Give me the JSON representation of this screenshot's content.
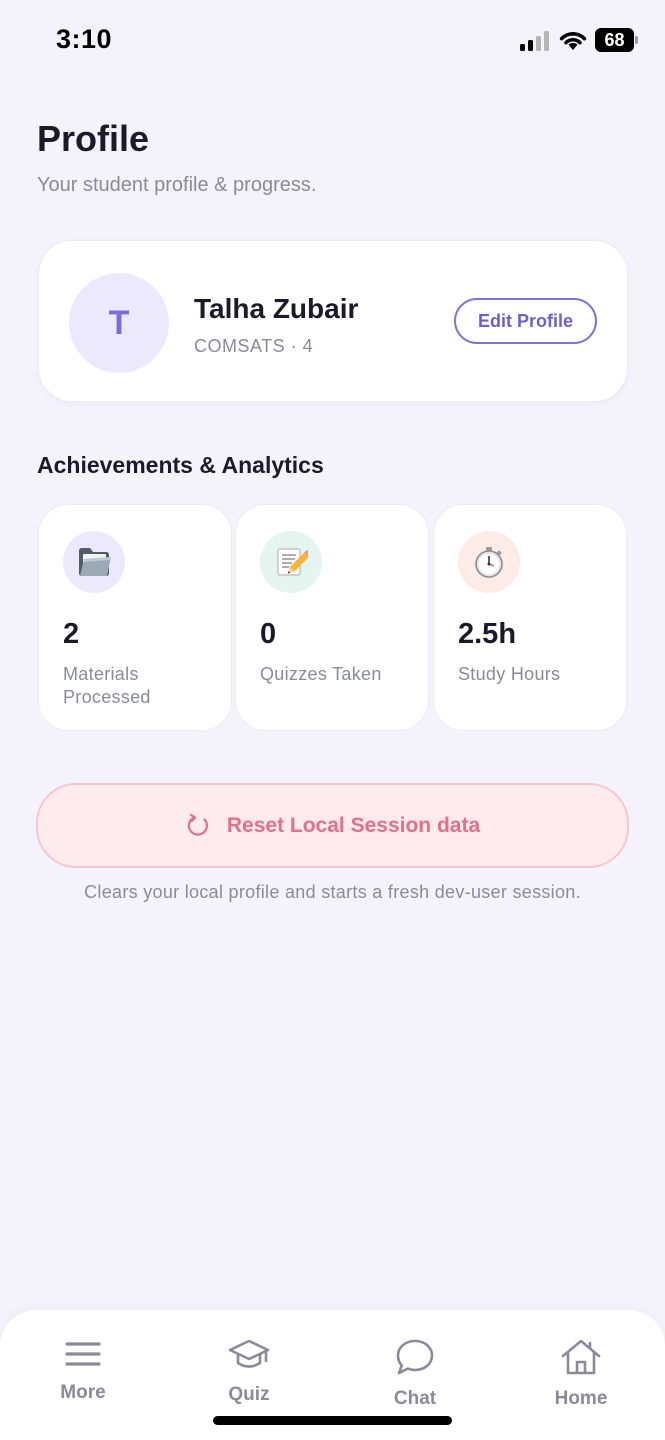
{
  "status_bar": {
    "time": "3:10",
    "battery": "68"
  },
  "header": {
    "title": "Profile",
    "subtitle": "Your student profile & progress."
  },
  "profile": {
    "initial": "T",
    "name": "Talha Zubair",
    "meta": "COMSATS · 4",
    "edit_label": "Edit Profile"
  },
  "achievements": {
    "title": "Achievements & Analytics",
    "stats": [
      {
        "icon": "folder-icon",
        "value": "2",
        "label": "Materials Processed",
        "bg": "#ECE9FD"
      },
      {
        "icon": "memo-pencil-icon",
        "value": "0",
        "label": "Quizzes Taken",
        "bg": "#E4F5EF"
      },
      {
        "icon": "stopwatch-icon",
        "value": "2.5h",
        "label": "Study Hours",
        "bg": "#FCEBE6"
      }
    ]
  },
  "reset": {
    "label": "Reset Local Session data",
    "note": "Clears your local profile and starts a fresh dev-user session."
  },
  "nav": {
    "items": [
      {
        "icon": "menu-icon",
        "label": "More"
      },
      {
        "icon": "graduation-cap-icon",
        "label": "Quiz"
      },
      {
        "icon": "chat-bubble-icon",
        "label": "Chat"
      },
      {
        "icon": "home-icon",
        "label": "Home"
      }
    ]
  },
  "colors": {
    "background": "#F4F3FB",
    "accent": "#7B6CD8",
    "danger": "#E36F8B",
    "danger_bg": "#FDEBEE"
  }
}
